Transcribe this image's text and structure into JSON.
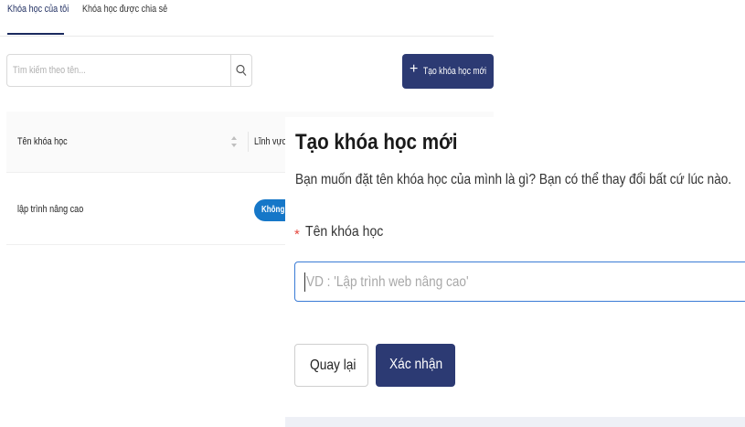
{
  "tabs": [
    {
      "label": "Khóa học của tôi",
      "active": true
    },
    {
      "label": "Khóa học được chia sẻ",
      "active": false
    }
  ],
  "search": {
    "placeholder": "Tìm kiếm theo tên...",
    "icon": "search-icon"
  },
  "create_button": {
    "icon": "plus-icon",
    "label": "Tạo khóa học mới"
  },
  "table": {
    "columns": [
      "Tên khóa học",
      "Lĩnh vực"
    ],
    "rows": [
      {
        "name": "lập trình nâng cao",
        "field_tag": "Không c"
      }
    ]
  },
  "modal": {
    "title": "Tạo khóa học mới",
    "description": "Bạn muốn đặt tên khóa học của mình là gì? Bạn có thể thay đổi bất cứ lúc nào.",
    "required_mark": "*",
    "field_label": "Tên khóa học",
    "input_placeholder": "VD : 'Lập trình web nâng cao'",
    "input_value": "",
    "back_label": "Quay lại",
    "confirm_label": "Xác nhận"
  },
  "colors": {
    "primary": "#2c3a73",
    "tag_blue": "#1677c8",
    "required_red": "#e5483f",
    "input_focus": "#3a7bd5"
  }
}
